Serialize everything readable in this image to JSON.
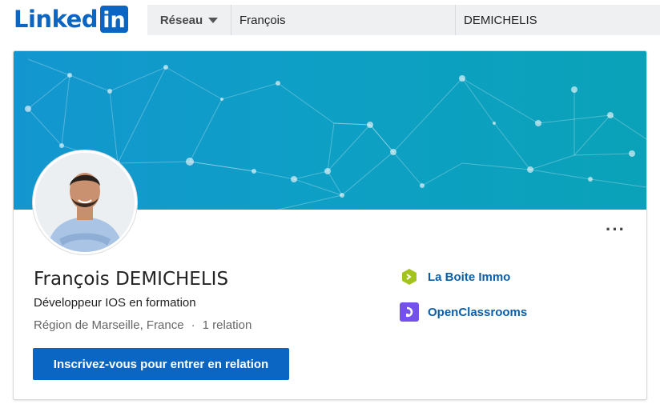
{
  "brand": {
    "logo_text": "Linked",
    "logo_box": "in",
    "color": "#0a66c2"
  },
  "search": {
    "network_label": "Réseau",
    "first_name": "François",
    "last_name": "DEMICHELIS"
  },
  "profile": {
    "name": "François DEMICHELIS",
    "headline": "Développeur IOS en formation",
    "location": "Région de Marseille, France",
    "separator": "·",
    "connections": "1 relation",
    "cta_label": "Inscrivez-vous pour entrer en relation",
    "more_label": "···"
  },
  "companies": [
    {
      "name": "La Boite Immo",
      "icon": "la-boite-immo-logo-icon"
    },
    {
      "name": "OpenClassrooms",
      "icon": "openclassrooms-logo-icon"
    }
  ],
  "colors": {
    "accent": "#0a66c2",
    "banner": "#0e9fc6",
    "link": "#0a5ea8"
  }
}
